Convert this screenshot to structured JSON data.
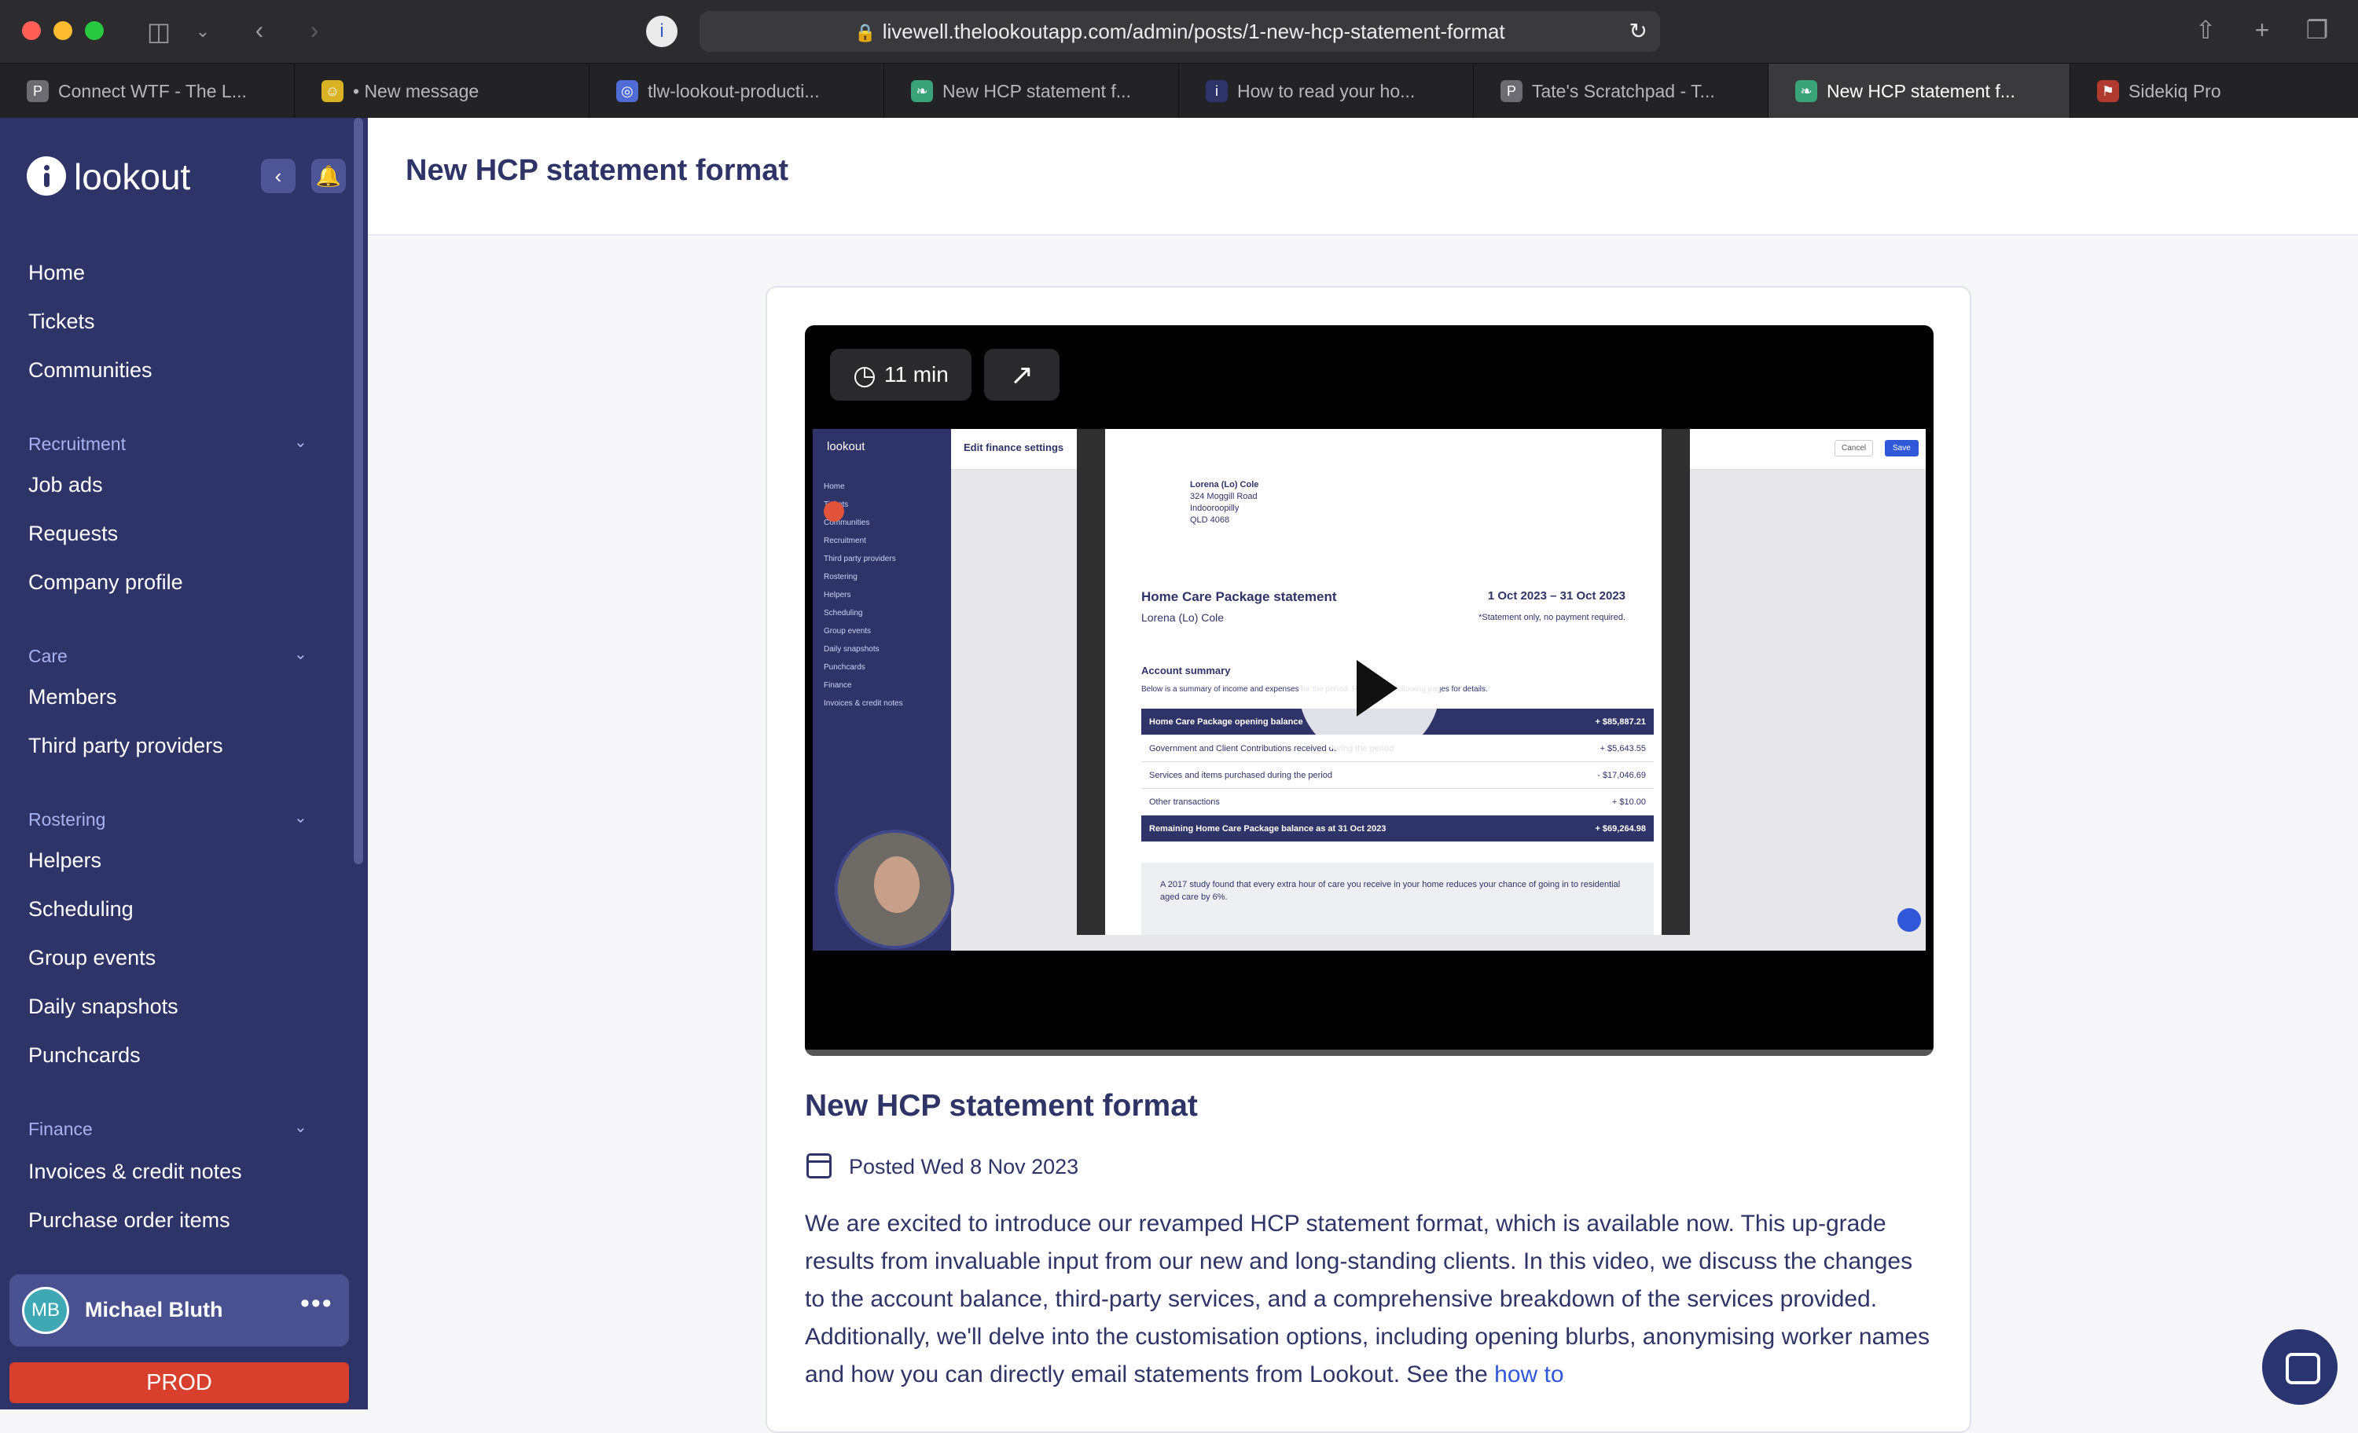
{
  "browser": {
    "url": "livewell.thelookoutapp.com/admin/posts/1-new-hcp-statement-format",
    "tabs": [
      {
        "label": "Connect WTF - The L...",
        "favicon": "P",
        "color": "#6c6c72"
      },
      {
        "label": "• New message",
        "favicon": "☺",
        "color": "#d9b323"
      },
      {
        "label": "tlw-lookout-producti...",
        "favicon": "◎",
        "color": "#4f6bd6"
      },
      {
        "label": "New HCP statement f...",
        "favicon": "❧",
        "color": "#3aa37a"
      },
      {
        "label": "How to read your ho...",
        "favicon": "i",
        "color": "#2e3468"
      },
      {
        "label": "Tate's Scratchpad - T...",
        "favicon": "P",
        "color": "#6c6c72"
      },
      {
        "label": "New HCP statement f...",
        "favicon": "❧",
        "color": "#3aa37a"
      },
      {
        "label": "Sidekiq Pro",
        "favicon": "⚑",
        "color": "#b03a2e"
      }
    ]
  },
  "sidebar": {
    "brand": "lookout",
    "top_items": [
      "Home",
      "Tickets",
      "Communities"
    ],
    "sections": [
      {
        "title": "Recruitment",
        "items": [
          "Job ads",
          "Requests",
          "Company profile"
        ]
      },
      {
        "title": "Care",
        "items": [
          "Members",
          "Third party providers"
        ]
      },
      {
        "title": "Rostering",
        "items": [
          "Helpers",
          "Scheduling",
          "Group events",
          "Daily snapshots",
          "Punchcards"
        ]
      },
      {
        "title": "Finance",
        "items": [
          "Invoices & credit notes",
          "Purchase order items"
        ]
      }
    ],
    "user": {
      "initials": "MB",
      "name": "Michael Bluth"
    },
    "env_label": "PROD"
  },
  "main": {
    "page_title": "New HCP statement format",
    "video": {
      "duration": "11 min",
      "screenshot": {
        "app_brand": "lookout",
        "topbar_title": "Edit finance settings",
        "cancel": "Cancel",
        "save": "Save",
        "side_items": [
          "Home",
          "Tickets",
          "Communities",
          "Recruitment",
          "Third party providers",
          "Rostering",
          "Helpers",
          "Scheduling",
          "Group events",
          "Daily snapshots",
          "Punchcards",
          "Finance",
          "Invoices & credit notes"
        ],
        "statement": {
          "address": [
            "Lorena (Lo) Cole",
            "324 Moggill Road",
            "Indooroopilly",
            "QLD 4068"
          ],
          "heading": "Home Care Package statement",
          "period": "1 Oct 2023 – 31 Oct 2023",
          "client": "Lorena (Lo) Cole",
          "note": "*Statement only, no payment required.",
          "summary_title": "Account summary",
          "summary_intro": "Below is a summary of income and expenses for the period. Refer to the following pages for details.",
          "rows": [
            {
              "label": "Home Care Package opening balance",
              "value": "+ $85,887.21"
            },
            {
              "label": "Government and Client Contributions received during the period",
              "value": "+ $5,643.55"
            },
            {
              "label": "Services and items purchased during the period",
              "value": "- $17,046.69"
            },
            {
              "label": "Other transactions",
              "value": "+ $10.00"
            },
            {
              "label": "Remaining Home Care Package balance as at 31 Oct 2023",
              "value": "+ $69,264.98"
            }
          ],
          "quote": "A 2017 study found that every extra hour of care you receive in your home reduces your chance of going in to residential aged care by 6%."
        }
      }
    },
    "post": {
      "title": "New HCP statement format",
      "posted": "Posted Wed 8 Nov 2023",
      "body_visible": "We are excited to introduce our revamped HCP statement format, which is available now. This up-grade results from invaluable input from our new and long-standing clients. In this video, we discuss the changes to the account balance, third-party services, and a comprehensive breakdown of the services provided. Additionally, we'll delve into the customisation options, including opening blurbs, anonymising worker names and how you can directly email statements from Lookout. See the ",
      "link": "how to"
    }
  },
  "colors": {
    "sidebar_bg": "#2e3468",
    "accent_text": "#2e3468",
    "section_label": "#a9b1f0",
    "prod_badge": "#d8402d",
    "link": "#2f57d8"
  }
}
